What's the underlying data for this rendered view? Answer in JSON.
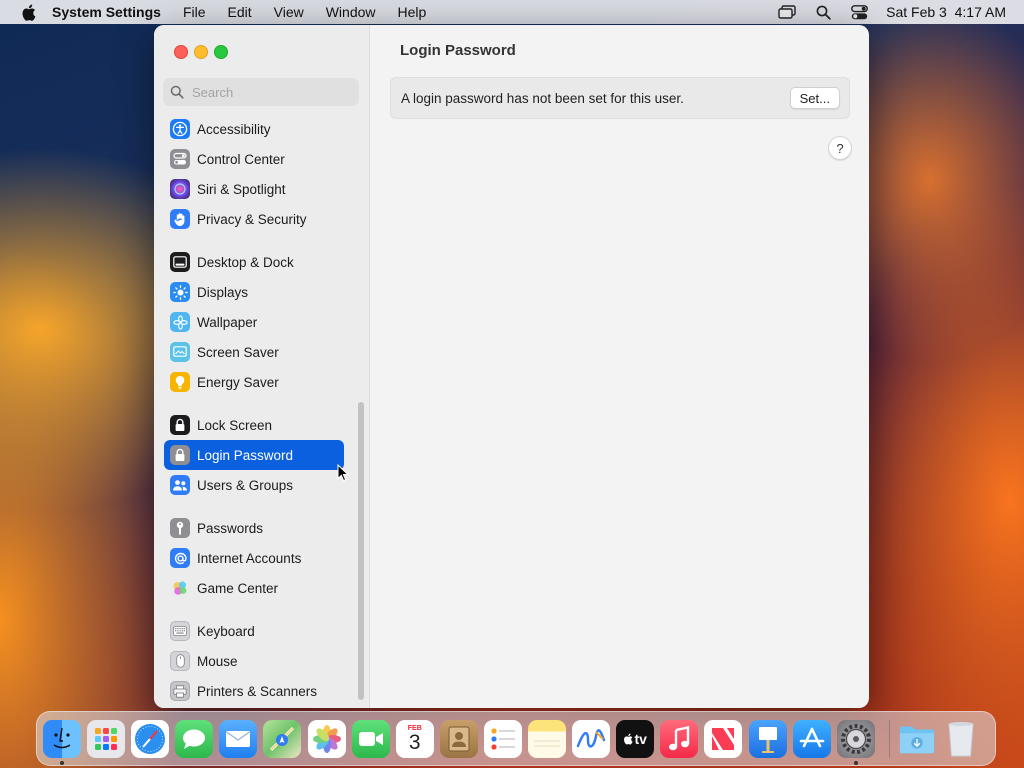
{
  "menubar": {
    "app_name": "System Settings",
    "menus": [
      "File",
      "Edit",
      "View",
      "Window",
      "Help"
    ],
    "clock": "Sat Feb 3  4:17 AM"
  },
  "sidebar": {
    "search_placeholder": "Search",
    "items": [
      {
        "label": "Accessibility",
        "icon": "accessibility-icon",
        "color": "#1e7cf2"
      },
      {
        "label": "Control Center",
        "icon": "control-center-icon",
        "color": "#8e8e93"
      },
      {
        "label": "Siri & Spotlight",
        "icon": "siri-icon",
        "color": "#5b3fd6"
      },
      {
        "label": "Privacy & Security",
        "icon": "hand-icon",
        "color": "#2f7cf6"
      },
      {
        "label": "Desktop & Dock",
        "icon": "dock-icon",
        "color": "#1c1c1e"
      },
      {
        "label": "Displays",
        "icon": "sun-icon",
        "color": "#2a8cf0"
      },
      {
        "label": "Wallpaper",
        "icon": "wallpaper-icon",
        "color": "#4fb6f0"
      },
      {
        "label": "Screen Saver",
        "icon": "screen-saver-icon",
        "color": "#5bc2e8"
      },
      {
        "label": "Energy Saver",
        "icon": "lightbulb-icon",
        "color": "#f7b500"
      },
      {
        "label": "Lock Screen",
        "icon": "lock-icon",
        "color": "#1c1c1e"
      },
      {
        "label": "Login Password",
        "icon": "lock-icon",
        "color": "#8e8e93",
        "selected": true
      },
      {
        "label": "Users & Groups",
        "icon": "users-icon",
        "color": "#2f7cf6"
      },
      {
        "label": "Passwords",
        "icon": "key-icon",
        "color": "#8e8e93"
      },
      {
        "label": "Internet Accounts",
        "icon": "at-icon",
        "color": "#2f7cf6"
      },
      {
        "label": "Game Center",
        "icon": "game-center-icon",
        "color": "#ffffff"
      },
      {
        "label": "Keyboard",
        "icon": "keyboard-icon",
        "color": "#b0b0b5"
      },
      {
        "label": "Mouse",
        "icon": "mouse-icon",
        "color": "#b0b0b5"
      },
      {
        "label": "Printers & Scanners",
        "icon": "printer-icon",
        "color": "#9a9aa0"
      }
    ]
  },
  "content": {
    "title": "Login Password",
    "message": "A login password has not been set for this user.",
    "set_button": "Set...",
    "help": "?"
  },
  "dock": {
    "apps": [
      {
        "name": "Finder",
        "icon": "finder-icon",
        "color": "#2f8bf5",
        "running": true
      },
      {
        "name": "Launchpad",
        "icon": "launchpad-icon",
        "color": "#e8e8ec"
      },
      {
        "name": "Safari",
        "icon": "safari-icon",
        "color": "#2b8ff0"
      },
      {
        "name": "Messages",
        "icon": "messages-icon",
        "color": "#35c759"
      },
      {
        "name": "Mail",
        "icon": "mail-icon",
        "color": "#3a8ef5"
      },
      {
        "name": "Maps",
        "icon": "maps-icon",
        "color": "#7ac86a"
      },
      {
        "name": "Photos",
        "icon": "photos-icon",
        "color": "#ffffff"
      },
      {
        "name": "FaceTime",
        "icon": "facetime-icon",
        "color": "#34c759"
      },
      {
        "name": "Calendar",
        "icon": "calendar-icon",
        "color": "#ffffff",
        "month": "FEB",
        "day": "3"
      },
      {
        "name": "Contacts",
        "icon": "contacts-icon",
        "color": "#b08a5a"
      },
      {
        "name": "Reminders",
        "icon": "reminders-icon",
        "color": "#ffffff"
      },
      {
        "name": "Notes",
        "icon": "notes-icon",
        "color": "#fde47a"
      },
      {
        "name": "Freeform",
        "icon": "freeform-icon",
        "color": "#ffffff"
      },
      {
        "name": "TV",
        "icon": "tv-icon",
        "color": "#111111",
        "label": "tv"
      },
      {
        "name": "Music",
        "icon": "music-icon",
        "color": "#fa3c55"
      },
      {
        "name": "News",
        "icon": "news-icon",
        "color": "#ffffff"
      },
      {
        "name": "Keynote",
        "icon": "keynote-icon",
        "color": "#2e8ef5"
      },
      {
        "name": "App Store",
        "icon": "app-store-icon",
        "color": "#1f8ef3"
      },
      {
        "name": "System Settings",
        "icon": "system-settings-icon",
        "color": "#8e8e93",
        "running": true
      },
      {
        "name": "Downloads",
        "icon": "downloads-folder-icon",
        "color": "#5ab5ec"
      },
      {
        "name": "Trash",
        "icon": "trash-icon",
        "color": "#e2e6ea"
      }
    ]
  }
}
